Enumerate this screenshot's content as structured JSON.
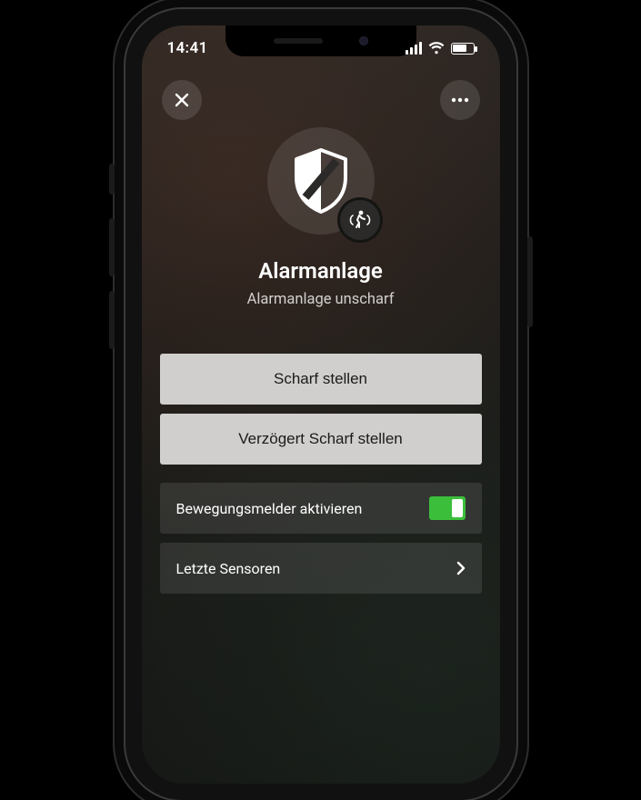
{
  "status": {
    "time": "14:41"
  },
  "hero": {
    "title": "Alarmanlage",
    "subtitle": "Alarmanlage unscharf"
  },
  "actions": {
    "arm": "Scharf stellen",
    "armDelayed": "Verzögert Scharf stellen"
  },
  "rows": {
    "motion": {
      "label": "Bewegungsmelder aktivieren",
      "on": true
    },
    "sensors": {
      "label": "Letzte Sensoren"
    }
  }
}
